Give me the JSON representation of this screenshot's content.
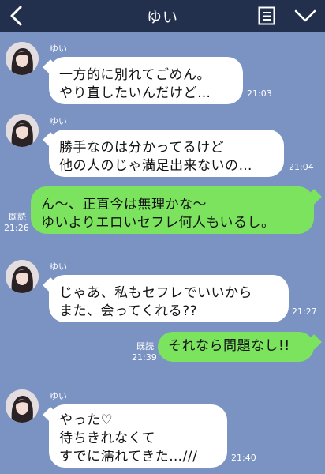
{
  "header": {
    "title": "ゆい",
    "back_icon": "back-arrow-icon",
    "menu_icon": "menu-icon",
    "chevron_icon": "chevron-down-icon"
  },
  "colors": {
    "header_bg": "#22304d",
    "chat_bg": "#7b93c2",
    "incoming_bubble": "#ffffff",
    "outgoing_bubble": "#7ce35f"
  },
  "messages": [
    {
      "sender": "ゆい",
      "text": "一方的に別れてごめん。\nやり直したいんだけど…",
      "time": "21:03"
    },
    {
      "sender": "ゆい",
      "text": "勝手なのは分かってるけど\n他の人のじゃ満足出来ないの…",
      "time": "21:04"
    },
    {
      "read": "既読",
      "text": "ん〜、正直今は無理かな〜\nゆいよりエロいセフレ何人もいるし。",
      "time": "21:26"
    },
    {
      "sender": "ゆい",
      "text": "じゃあ、私もセフレでいいから\nまた、会ってくれる??",
      "time": "21:27"
    },
    {
      "read": "既読",
      "text": "それなら問題なし!!",
      "time": "21:39"
    },
    {
      "sender": "ゆい",
      "text": "やった♡\n待ちきれなくて\nすでに濡れてきた…///",
      "time": "21:40"
    }
  ]
}
